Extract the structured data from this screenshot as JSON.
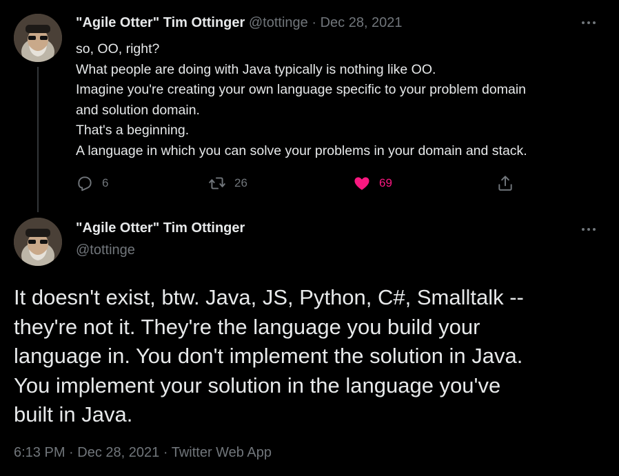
{
  "tweet1": {
    "author_name": "\"Agile Otter\" Tim Ottinger",
    "handle": "@tottinge",
    "separator": "·",
    "date": "Dec 28, 2021",
    "lines": [
      "so, OO, right?",
      "What people are doing with Java typically is nothing like OO.",
      "Imagine you're creating your own language specific to your problem domain",
      "and solution domain.",
      "That's a beginning.",
      "A language in which you can solve your problems in your domain and stack."
    ],
    "reply_count": "6",
    "retweet_count": "26",
    "like_count": "69",
    "like_color": "#f91880"
  },
  "tweet2": {
    "author_name": "\"Agile Otter\" Tim Ottinger",
    "handle": "@tottinge",
    "lines": [
      "It doesn't exist, btw. Java, JS, Python, C#, Smalltalk --",
      "they're not it. They're the language you build your",
      "language in. You don't implement the solution in Java.",
      "You implement your solution in the language you've",
      "built in Java."
    ],
    "time": "6:13 PM",
    "date": "Dec 28, 2021",
    "source": "Twitter Web App",
    "separator": "·"
  },
  "icons": {
    "reply": "reply-icon",
    "retweet": "retweet-icon",
    "like": "heart-icon",
    "share": "share-icon",
    "more": "more-icon"
  }
}
